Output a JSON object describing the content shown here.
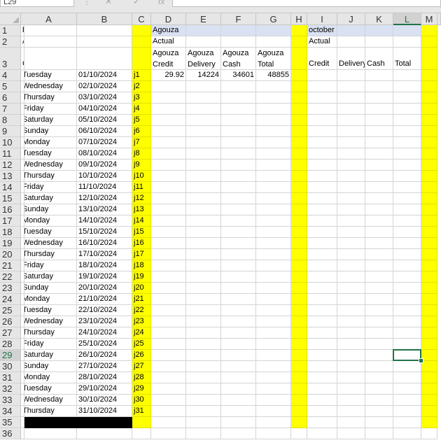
{
  "formula_bar": {
    "name_box": "L29",
    "cancel_glyph": "✕",
    "enter_glyph": "✓",
    "fx_label": "fx",
    "sep_glyph": "⋮",
    "content": ""
  },
  "columns": [
    "A",
    "B",
    "C",
    "D",
    "E",
    "F",
    "G",
    "H",
    "I",
    "J",
    "K",
    "L",
    "M"
  ],
  "selected_column": "L",
  "selected_row": 29,
  "rows": [
    1,
    2,
    3,
    4,
    5,
    6,
    7,
    8,
    9,
    10,
    11,
    12,
    13,
    14,
    15,
    16,
    17,
    18,
    19,
    20,
    21,
    22,
    23,
    24,
    25,
    26,
    27,
    28,
    29,
    30,
    31,
    32,
    33,
    34,
    35,
    36
  ],
  "header_block_agouza": {
    "row1": "Agouza",
    "row2": "Actual",
    "row3": [
      "Agouza\nCredit",
      "Agouza\nDelivery",
      "Agouza\nCash",
      "Agouza\nTotal"
    ]
  },
  "header_block_october": {
    "row1": "october",
    "row2": "Actual",
    "row3": [
      "Credit",
      "Delivery",
      "Cash",
      "Total"
    ]
  },
  "header_block_next": {
    "row1": "b",
    "row2": "A",
    "row3": "C"
  },
  "days": [
    {
      "day": "Tuesday",
      "date": "01/10/2024",
      "code": "j1"
    },
    {
      "day": "Wednesday",
      "date": "02/10/2024",
      "code": "j2"
    },
    {
      "day": "Thursday",
      "date": "03/10/2024",
      "code": "j3"
    },
    {
      "day": "Friday",
      "date": "04/10/2024",
      "code": "j4"
    },
    {
      "day": "Saturday",
      "date": "05/10/2024",
      "code": "j5"
    },
    {
      "day": "Sunday",
      "date": "06/10/2024",
      "code": "j6"
    },
    {
      "day": "Monday",
      "date": "07/10/2024",
      "code": "j7"
    },
    {
      "day": "Tuesday",
      "date": "08/10/2024",
      "code": "j8"
    },
    {
      "day": "Wednesday",
      "date": "09/10/2024",
      "code": "j9"
    },
    {
      "day": "Thursday",
      "date": "10/10/2024",
      "code": "j10"
    },
    {
      "day": "Friday",
      "date": "11/10/2024",
      "code": "j11"
    },
    {
      "day": "Saturday",
      "date": "12/10/2024",
      "code": "j12"
    },
    {
      "day": "Sunday",
      "date": "13/10/2024",
      "code": "j13"
    },
    {
      "day": "Monday",
      "date": "14/10/2024",
      "code": "j14"
    },
    {
      "day": "Tuesday",
      "date": "15/10/2024",
      "code": "j15"
    },
    {
      "day": "Wednesday",
      "date": "16/10/2024",
      "code": "j16"
    },
    {
      "day": "Thursday",
      "date": "17/10/2024",
      "code": "j17"
    },
    {
      "day": "Friday",
      "date": "18/10/2024",
      "code": "j18"
    },
    {
      "day": "Saturday",
      "date": "19/10/2024",
      "code": "j19"
    },
    {
      "day": "Sunday",
      "date": "20/10/2024",
      "code": "j20"
    },
    {
      "day": "Monday",
      "date": "21/10/2024",
      "code": "j21"
    },
    {
      "day": "Tuesday",
      "date": "22/10/2024",
      "code": "j22"
    },
    {
      "day": "Wednesday",
      "date": "23/10/2024",
      "code": "j23"
    },
    {
      "day": "Thursday",
      "date": "24/10/2024",
      "code": "j24"
    },
    {
      "day": "Friday",
      "date": "25/10/2024",
      "code": "j25"
    },
    {
      "day": "Saturday",
      "date": "26/10/2024",
      "code": "j26"
    },
    {
      "day": "Sunday",
      "date": "27/10/2024",
      "code": "j27"
    },
    {
      "day": "Monday",
      "date": "28/10/2024",
      "code": "j28"
    },
    {
      "day": "Tuesday",
      "date": "29/10/2024",
      "code": "j29"
    },
    {
      "day": "Wednesday",
      "date": "30/10/2024",
      "code": "j30"
    },
    {
      "day": "Thursday",
      "date": "31/10/2024",
      "code": "j31"
    }
  ],
  "agouza_row4": {
    "credit": "29.92",
    "delivery": "14224",
    "cash": "34601",
    "total": "48855"
  },
  "colors": {
    "highlight": "#ffff00",
    "header_fill": "#d9e1f2",
    "fill_black": "#000000",
    "selection": "#217346"
  }
}
